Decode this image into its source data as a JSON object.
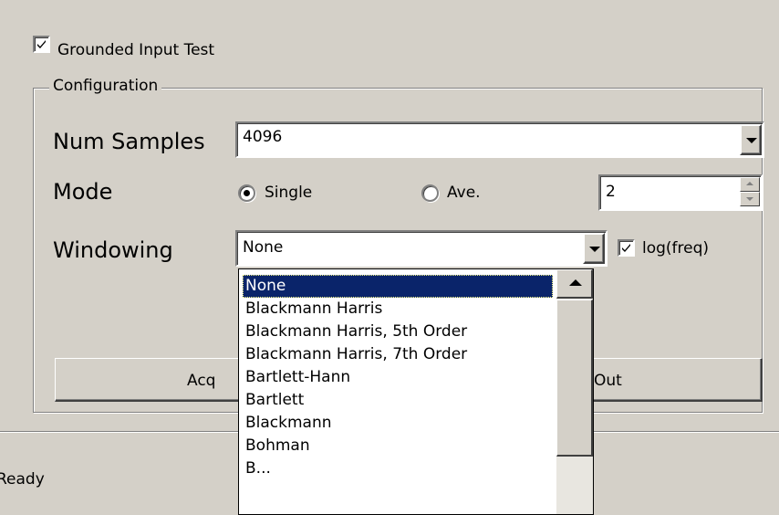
{
  "grounded_test": {
    "label": "Grounded Input Test",
    "checked": true
  },
  "config": {
    "legend": "Configuration",
    "num_samples": {
      "label": "Num Samples",
      "value": "4096"
    },
    "mode": {
      "label": "Mode",
      "options": [
        {
          "label": "Single",
          "selected": true
        },
        {
          "label": "Ave.",
          "selected": false
        }
      ],
      "averages_value": "2"
    },
    "windowing": {
      "label": "Windowing",
      "value": "None",
      "log_freq": {
        "label": "log(freq)",
        "checked": true
      },
      "options": [
        "None",
        "Blackmann Harris",
        "Blackmann Harris, 5th Order",
        "Blackmann Harris, 7th Order",
        "Bartlett-Hann",
        "Bartlett",
        "Blackmann",
        "Bohman",
        "B..."
      ],
      "selected_index": 0
    },
    "buttons": {
      "acquire_partial": "Acq",
      "out_partial": "Out"
    }
  },
  "status": {
    "text": "Ready",
    "visible_text": "eady"
  },
  "colors": {
    "window_bg": "#d4d0c8",
    "selection": "#0a246a"
  }
}
